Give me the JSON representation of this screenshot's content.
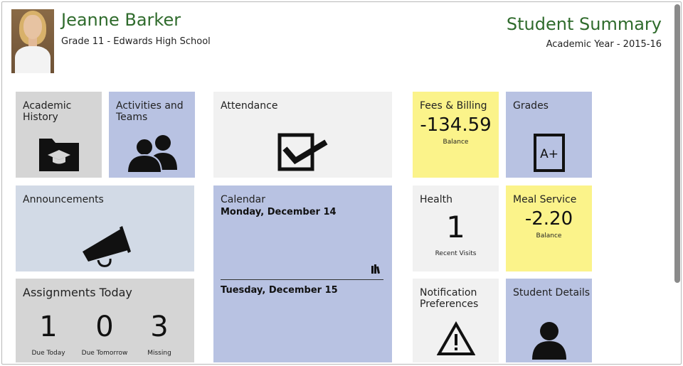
{
  "student": {
    "name": "Jeanne Barker",
    "grade_school": "Grade 11 - Edwards High School"
  },
  "header": {
    "title": "Student Summary",
    "academic_year": "Academic Year - 2015-16"
  },
  "tiles": {
    "academic_history": {
      "label": "Academic\nHistory",
      "icon": "folder-graduation-cap-icon"
    },
    "activities": {
      "label": "Activities and\nTeams",
      "icon": "people-icon"
    },
    "attendance": {
      "label": "Attendance",
      "icon": "checkbox-icon"
    },
    "fees": {
      "label": "Fees & Billing",
      "value": "-134.59",
      "sub": "Balance"
    },
    "grades": {
      "label": "Grades",
      "icon_text": "A+"
    },
    "announcements": {
      "label": "Announcements",
      "icon": "megaphone-icon"
    },
    "calendar": {
      "label": "Calendar",
      "day1": "Monday, December 14",
      "day2": "Tuesday, December 15",
      "icon": "books-icon"
    },
    "health": {
      "label": "Health",
      "value": "1",
      "sub": "Recent Visits"
    },
    "meal": {
      "label": "Meal Service",
      "value": "-2.20",
      "sub": "Balance"
    },
    "assignments": {
      "label": "Assignments Today",
      "items": [
        {
          "value": "1",
          "label": "Due Today"
        },
        {
          "value": "0",
          "label": "Due Tomorrow"
        },
        {
          "value": "3",
          "label": "Missing"
        }
      ]
    },
    "notifications": {
      "label": "Notification\nPreferences",
      "icon": "warning-icon"
    },
    "student_details": {
      "label": "Student Details",
      "icon": "person-icon"
    }
  },
  "colors": {
    "accent_green": "#2f6b2c",
    "tile_gray": "#d5d5d5",
    "tile_light": "#f1f1f1",
    "tile_blue": "#b8c2e2",
    "tile_steel": "#d2dae6",
    "tile_yellow": "#fbf38a"
  }
}
